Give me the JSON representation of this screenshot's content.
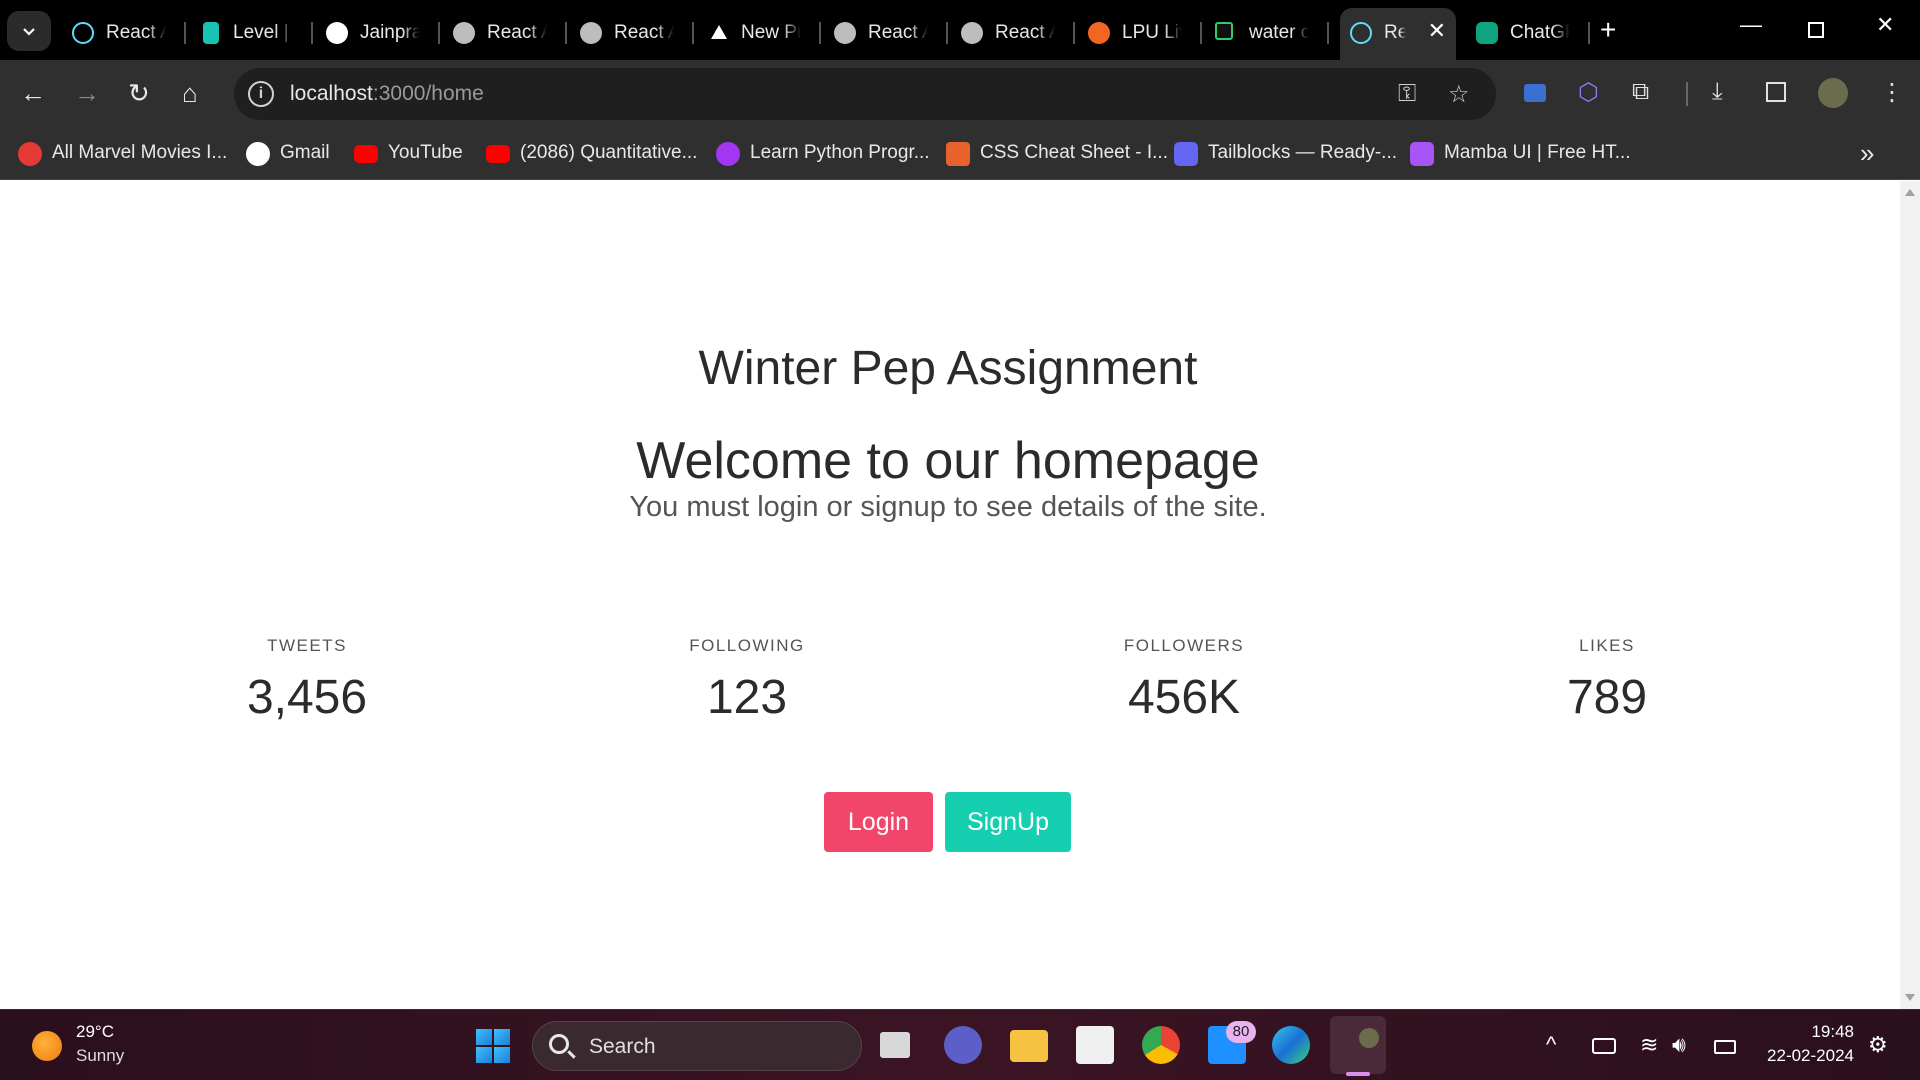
{
  "browser": {
    "tabs": [
      {
        "label": "React A",
        "icon": "react-icon",
        "color": "#61dafb"
      },
      {
        "label": "Level | I",
        "icon": "level-icon",
        "color": "#17c3b2"
      },
      {
        "label": "Jainpra",
        "icon": "github-icon",
        "color": "#ffffff"
      },
      {
        "label": "React A",
        "icon": "globe-icon",
        "color": "#bdbdbd"
      },
      {
        "label": "React A",
        "icon": "globe-icon",
        "color": "#bdbdbd"
      },
      {
        "label": "New Pr",
        "icon": "vercel-icon",
        "color": "#ffffff"
      },
      {
        "label": "React A",
        "icon": "globe-icon",
        "color": "#bdbdbd"
      },
      {
        "label": "React A",
        "icon": "globe-icon",
        "color": "#bdbdbd"
      },
      {
        "label": "LPU Liv",
        "icon": "lpu-icon",
        "color": "#f26522"
      },
      {
        "label": "water c",
        "icon": "hashnode-icon",
        "color": "#2ecc71"
      },
      {
        "label": "Re",
        "icon": "react-icon",
        "color": "#61dafb",
        "active": true
      },
      {
        "label": "ChatGP",
        "icon": "chatgpt-icon",
        "color": "#10a37f"
      }
    ],
    "url_host": "localhost",
    "url_path": ":3000/home",
    "bookmarks": [
      {
        "label": "All Marvel Movies I...",
        "icon": "tomato-icon",
        "color": "#e53935"
      },
      {
        "label": "Gmail",
        "icon": "google-icon",
        "color": "#ffffff"
      },
      {
        "label": "YouTube",
        "icon": "youtube-icon",
        "color": "#ff0000"
      },
      {
        "label": "(2086) Quantitative...",
        "icon": "youtube-icon",
        "color": "#ff0000"
      },
      {
        "label": "Learn Python Progr...",
        "icon": "udemy-icon",
        "color": "#a435f0"
      },
      {
        "label": "CSS Cheat Sheet - I...",
        "icon": "css-icon",
        "color": "#e8622c"
      },
      {
        "label": "Tailblocks — Ready-...",
        "icon": "tailblocks-icon",
        "color": "#6366f1"
      },
      {
        "label": "Mamba UI | Free HT...",
        "icon": "mamba-icon",
        "color": "#a855f7"
      }
    ]
  },
  "page": {
    "title": "Winter Pep Assignment",
    "welcome": "Welcome to our homepage",
    "subtitle": "You must login or signup to see details of the site.",
    "stats": [
      {
        "label": "TWEETS",
        "value": "3,456"
      },
      {
        "label": "FOLLOWING",
        "value": "123"
      },
      {
        "label": "FOLLOWERS",
        "value": "456K"
      },
      {
        "label": "LIKES",
        "value": "789"
      }
    ],
    "login_label": "Login",
    "signup_label": "SignUp",
    "login_color": "#f1456a",
    "signup_color": "#15cfb0"
  },
  "taskbar": {
    "weather_temp": "29°C",
    "weather_cond": "Sunny",
    "search_label": "Search",
    "badge_count": "80",
    "time": "19:48",
    "date": "22-02-2024"
  }
}
